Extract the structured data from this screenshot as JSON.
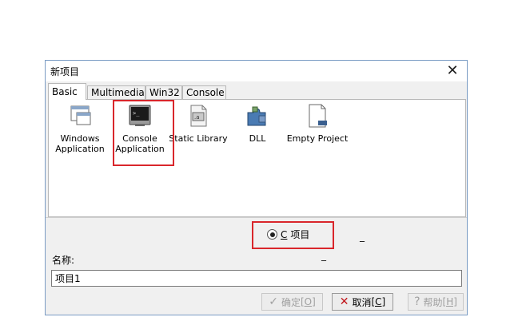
{
  "dialog": {
    "title": "新项目",
    "close_glyph": "✕"
  },
  "tabs": [
    {
      "label": "Basic",
      "active": true
    },
    {
      "label": "Multimedia",
      "active": false
    },
    {
      "label": "Win32",
      "active": false
    },
    {
      "label": "Console",
      "active": false
    }
  ],
  "templates": [
    {
      "line1": "Windows",
      "line2": "Application",
      "icon": "window-app-icon"
    },
    {
      "line1": "Console",
      "line2": "Application",
      "icon": "console-app-icon",
      "highlighted": true
    },
    {
      "line1": "Static Library",
      "line2": "",
      "icon": "static-library-icon"
    },
    {
      "line1": "DLL",
      "line2": "",
      "icon": "dll-puzzle-icon"
    },
    {
      "line1": "Empty Project",
      "line2": "",
      "icon": "empty-project-icon"
    }
  ],
  "language": {
    "option_c": "C",
    "option_suffix": "项目",
    "selected": true,
    "dash_a": "_",
    "dash_b": "_"
  },
  "name": {
    "label": "名称:",
    "value": "项目1"
  },
  "buttons": {
    "ok": {
      "text": "确定",
      "key": "[O]",
      "enabled": false
    },
    "cancel": {
      "text": "取消",
      "key": "[C]",
      "enabled": true
    },
    "help": {
      "text": "帮助",
      "key": "[H]",
      "enabled": false
    }
  },
  "colors": {
    "highlight": "#d9262b",
    "accent_border": "#7a9cc4"
  }
}
